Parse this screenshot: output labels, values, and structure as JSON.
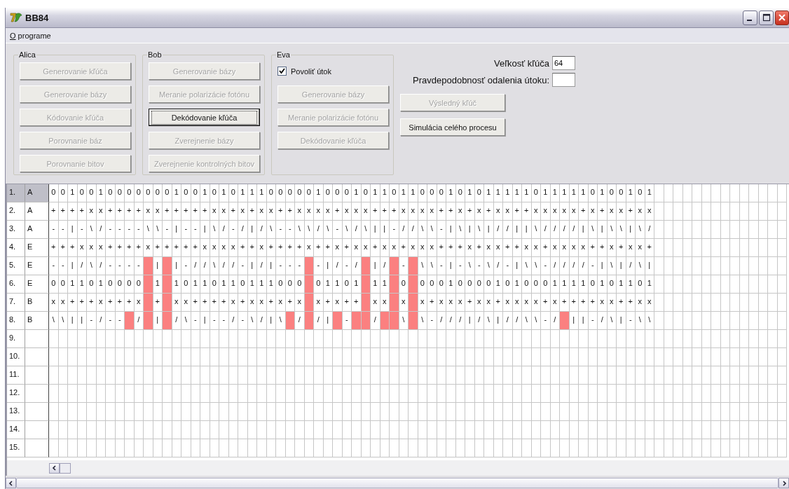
{
  "window": {
    "title": "BB84"
  },
  "menu": [
    {
      "label": "O programe"
    }
  ],
  "groups": [
    {
      "title": "Alica",
      "buttons": [
        {
          "label": "Generovanie kľúča",
          "disabled": true,
          "focused": false
        },
        {
          "label": "Generovanie bázy",
          "disabled": true,
          "focused": false
        },
        {
          "label": "Kódovanie kľúča",
          "disabled": true,
          "focused": false
        },
        {
          "label": "Porovnanie báz",
          "disabled": true,
          "focused": false
        },
        {
          "label": "Porovnanie bitov",
          "disabled": true,
          "focused": false
        }
      ]
    },
    {
      "title": "Bob",
      "buttons": [
        {
          "label": "Generovanie bázy",
          "disabled": true,
          "focused": false
        },
        {
          "label": "Meranie polarizácie fotónu",
          "disabled": true,
          "focused": false
        },
        {
          "label": "Dekódovanie kľúča",
          "disabled": false,
          "focused": true
        },
        {
          "label": "Zverejnenie bázy",
          "disabled": true,
          "focused": false
        },
        {
          "label": "Zverejnenie kontrolných bitov",
          "disabled": true,
          "focused": false
        }
      ]
    },
    {
      "title": "Eva",
      "checkbox": {
        "label": "Povoliť útok",
        "checked": true
      },
      "buttons": [
        {
          "label": "Generovanie bázy",
          "disabled": true,
          "focused": false
        },
        {
          "label": "Meranie polarizácie fotónu",
          "disabled": true,
          "focused": false
        },
        {
          "label": "Dekódovanie kľúča",
          "disabled": true,
          "focused": false
        }
      ]
    }
  ],
  "settings": {
    "fields": [
      {
        "label": "Veľkosť kľúča",
        "value": "64"
      },
      {
        "label": "Pravdepodobnosť odalenia útoku:"
      }
    ],
    "actions": [
      {
        "label": "Výsledný kľúč",
        "disabled": true
      },
      {
        "label": "Simulácia celého procesu",
        "disabled": false
      }
    ]
  },
  "grid": {
    "rows": [
      {
        "number": "1.",
        "party": "A",
        "selected": true,
        "cells": [
          "0",
          "0",
          "1",
          "0",
          "0",
          "1",
          "0",
          "0",
          "0",
          "0",
          "0",
          "0",
          "0",
          "1",
          "0",
          "0",
          "1",
          "0",
          "1",
          "0",
          "1",
          "1",
          "1",
          "0",
          "0",
          "0",
          "0",
          "0",
          "1",
          "0",
          "0",
          "0",
          "1",
          "0",
          "1",
          "1",
          "0",
          "1",
          "1",
          "0",
          "0",
          "0",
          "1",
          "0",
          "1",
          "0",
          "1",
          "1",
          "1",
          "1",
          "1",
          "0",
          "1",
          "1",
          "1",
          "1",
          "1",
          "0",
          "1",
          "0",
          "0",
          "1",
          "0",
          "1"
        ]
      },
      {
        "number": "2.",
        "party": "A",
        "selected": false,
        "cells": [
          "+",
          "+",
          "+",
          "+",
          "x",
          "x",
          "+",
          "+",
          "+",
          "+",
          "x",
          "x",
          "+",
          "+",
          "+",
          "+",
          "+",
          "x",
          "x",
          "+",
          "x",
          "+",
          "x",
          "x",
          "+",
          "+",
          "x",
          "x",
          "x",
          "x",
          "+",
          "x",
          "x",
          "x",
          "+",
          "+",
          "+",
          "x",
          "x",
          "x",
          "x",
          "+",
          "+",
          "x",
          "+",
          "x",
          "+",
          "x",
          "x",
          "+",
          "+",
          "x",
          "x",
          "x",
          "x",
          "x",
          "+",
          "x",
          "+",
          "x",
          "x",
          "+",
          "x",
          "x"
        ]
      },
      {
        "number": "3.",
        "party": "A",
        "selected": false,
        "cells": [
          "-",
          "-",
          "|",
          "-",
          "\\",
          "/",
          "-",
          "-",
          "-",
          "-",
          "\\",
          "\\",
          "-",
          "|",
          "-",
          "-",
          "|",
          "\\",
          "/",
          "-",
          "/",
          "|",
          "/",
          "\\",
          "-",
          "-",
          "\\",
          "\\",
          "/",
          "\\",
          "-",
          "\\",
          "/",
          "\\",
          "|",
          "|",
          "-",
          "/",
          "/",
          "\\",
          "\\",
          "-",
          "|",
          "\\",
          "|",
          "\\",
          "|",
          "/",
          "/",
          "|",
          "|",
          "\\",
          "/",
          "/",
          "/",
          "/",
          "|",
          "\\",
          "|",
          "\\",
          "\\",
          "|",
          "\\",
          "/"
        ]
      },
      {
        "number": "4.",
        "party": "E",
        "selected": false,
        "cells": [
          "+",
          "+",
          "+",
          "x",
          "x",
          "x",
          "+",
          "+",
          "+",
          "+",
          "x",
          "+",
          "+",
          "+",
          "+",
          "+",
          "x",
          "x",
          "x",
          "x",
          "+",
          "+",
          "x",
          "+",
          "+",
          "+",
          "+",
          "x",
          "+",
          "+",
          "x",
          "+",
          "x",
          "x",
          "+",
          "x",
          "x",
          "+",
          "x",
          "x",
          "x",
          "+",
          "+",
          "+",
          "x",
          "+",
          "x",
          "x",
          "+",
          "+",
          "x",
          "x",
          "+",
          "x",
          "x",
          "x",
          "x",
          "+",
          "+",
          "x",
          "+",
          "x",
          "x",
          "+"
        ]
      },
      {
        "number": "5.",
        "party": "E",
        "selected": false,
        "cells": [
          "-",
          "-",
          "|",
          "/",
          "\\",
          "/",
          "-",
          "-",
          "-",
          "-",
          {
            "highlighted": true
          },
          "|",
          {
            "highlighted": true
          },
          "|",
          "-",
          "/",
          "/",
          "\\",
          "/",
          "/",
          "-",
          "|",
          "/",
          "|",
          "-",
          "-",
          "-",
          {
            "highlighted": true
          },
          "-",
          "|",
          "/",
          "-",
          "/",
          {
            "highlighted": true
          },
          "|",
          "/",
          {
            "highlighted": true
          },
          "-",
          {
            "highlighted": true
          },
          "\\",
          "\\",
          "-",
          "|",
          "-",
          "\\",
          "-",
          "\\",
          "/",
          "-",
          "|",
          "\\",
          "\\",
          "-",
          "/",
          "/",
          "/",
          "/",
          "-",
          "|",
          "\\",
          "|",
          "/",
          "\\",
          "|"
        ]
      },
      {
        "number": "6.",
        "party": "E",
        "selected": false,
        "cells": [
          "0",
          "0",
          "1",
          "1",
          "0",
          "1",
          "0",
          "0",
          "0",
          "0",
          {
            "highlighted": true
          },
          "1",
          {
            "highlighted": true
          },
          "1",
          "0",
          "1",
          "1",
          "0",
          "1",
          "1",
          "0",
          "1",
          "1",
          "1",
          "0",
          "0",
          "0",
          {
            "highlighted": true
          },
          "0",
          "1",
          "1",
          "0",
          "1",
          {
            "highlighted": true
          },
          "1",
          "1",
          {
            "highlighted": true
          },
          "0",
          {
            "highlighted": true
          },
          "0",
          "0",
          "0",
          "1",
          "0",
          "0",
          "0",
          "0",
          "1",
          "0",
          "1",
          "0",
          "0",
          "0",
          "1",
          "1",
          "1",
          "1",
          "0",
          "1",
          "0",
          "1",
          "1",
          "0",
          "1"
        ]
      },
      {
        "number": "7.",
        "party": "B",
        "selected": false,
        "cells": [
          "x",
          "x",
          "+",
          "+",
          "+",
          "x",
          "+",
          "+",
          "+",
          "x",
          {
            "highlighted": true
          },
          "+",
          {
            "highlighted": true
          },
          "x",
          "x",
          "+",
          "+",
          "+",
          "+",
          "x",
          "+",
          "x",
          "x",
          "+",
          "x",
          "+",
          "x",
          {
            "highlighted": true
          },
          "x",
          "+",
          "x",
          "+",
          "+",
          {
            "highlighted": true
          },
          "x",
          "x",
          {
            "highlighted": true
          },
          "x",
          {
            "highlighted": true
          },
          "x",
          "+",
          "x",
          "x",
          "x",
          "+",
          "x",
          "x",
          "+",
          "x",
          "x",
          "x",
          "x",
          "+",
          "x",
          "+",
          "+",
          "+",
          "+",
          "x",
          "x",
          "+",
          "+",
          "x",
          "x"
        ]
      },
      {
        "number": "8.",
        "party": "B",
        "selected": false,
        "cells": [
          "\\",
          "\\",
          "|",
          "|",
          "-",
          "/",
          "-",
          "-",
          {
            "highlighted": true
          },
          "/",
          {
            "highlighted": true
          },
          "|",
          {
            "highlighted": true
          },
          "/",
          "\\",
          "-",
          "|",
          "-",
          "-",
          "/",
          "-",
          "\\",
          "/",
          "|",
          "\\",
          {
            "highlighted": true
          },
          "/",
          {
            "highlighted": true
          },
          "/",
          "|",
          {
            "highlighted": true
          },
          "-",
          {
            "highlighted": true
          },
          {
            "highlighted": true
          },
          "/",
          {
            "highlighted": true
          },
          {
            "highlighted": true
          },
          "\\",
          {
            "highlighted": true
          },
          "\\",
          "-",
          "/",
          "/",
          "/",
          "|",
          "/",
          "\\",
          "|",
          "/",
          "/",
          "\\",
          "\\",
          "-",
          "/",
          {
            "highlighted": true
          },
          "|",
          "|",
          "-",
          "/",
          "\\",
          "|",
          "-",
          "\\",
          "\\"
        ]
      },
      {
        "number": "9.",
        "party": "",
        "selected": false
      },
      {
        "number": "10.",
        "selected": false
      },
      {
        "number": "11.",
        "selected": false
      },
      {
        "number": "12.",
        "selected": false
      },
      {
        "number": "13.",
        "selected": false
      },
      {
        "number": "14.",
        "selected": false
      },
      {
        "number": "15.",
        "selected": false
      }
    ]
  }
}
